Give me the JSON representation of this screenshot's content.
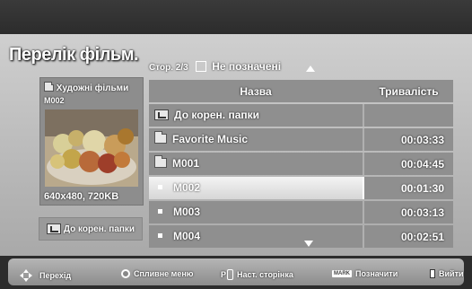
{
  "page_title": "Перелік фільм.",
  "page_info": {
    "page": "Стор. 2/3",
    "check_glyph": "☑",
    "mark_label": "Не позначені"
  },
  "preview": {
    "folder": "Художні фільми",
    "file": "M002",
    "resolution": "640x480, 720KB"
  },
  "root_button": "До корен. папки",
  "columns": {
    "name": "Назва",
    "duration": "Тривалість"
  },
  "rows": [
    {
      "name": "До корен. папки",
      "duration": "",
      "icon": "root-folder-icon"
    },
    {
      "name": "Favorite Music",
      "duration": "00:03:33",
      "icon": "folder-icon"
    },
    {
      "name": "M001",
      "duration": "00:04:45",
      "icon": "folder-icon"
    },
    {
      "name": "M002",
      "duration": "00:01:30",
      "icon": "file-bullet-icon"
    },
    {
      "name": "M003",
      "duration": "00:03:13",
      "icon": "file-bullet-icon"
    },
    {
      "name": "M004",
      "duration": "00:02:51",
      "icon": "file-bullet-icon"
    }
  ],
  "selected_row": 3,
  "hints": {
    "navigate": "Перехід",
    "popup": "Спливне меню",
    "page_key": "P",
    "next_page": "Наст. сторінка",
    "mark_key": "MARK",
    "mark": "Позначити",
    "exit": "Вийти"
  }
}
